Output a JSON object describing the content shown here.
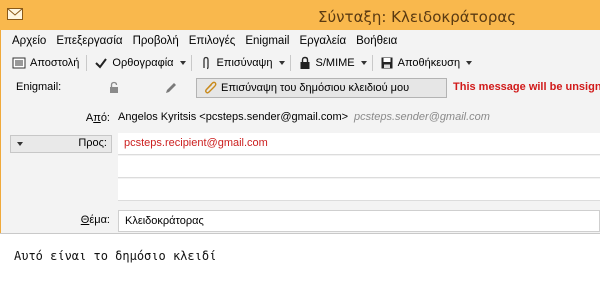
{
  "window": {
    "title": "Σύνταξη: Κλειδοκράτορας"
  },
  "menu": [
    "Αρχείο",
    "Επεξεργασία",
    "Προβολή",
    "Επιλογές",
    "Enigmail",
    "Εργαλεία",
    "Βοήθεια"
  ],
  "toolbar": {
    "send_label": "Αποστολή",
    "spelling_label": "Ορθογραφία",
    "attach_label": "Επισύναψη",
    "smime_label": "S/MIME",
    "save_label": "Αποθήκευση"
  },
  "enigmail_bar": {
    "label": "Enigmail:",
    "attach_key_label": "Επισύναψη του δημόσιου κλειδιού μου",
    "status_message": "This message will be unsign"
  },
  "header": {
    "from_label": "Από:",
    "from_value": "Angelos Kyritsis <pcsteps.sender@gmail.com>",
    "from_identity": "pcsteps.sender@gmail.com",
    "to_label": "Προς:",
    "to_value": "pcsteps.recipient@gmail.com",
    "subject_label": "Θέμα:",
    "subject_value": "Κλειδοκράτορας"
  },
  "body": {
    "text": "Αυτό είναι το δημόσιο κλειδί"
  },
  "colors": {
    "titlebar": "#f9b84d",
    "warning_red": "#d11a1a",
    "recipient_red": "#cc1f1f"
  }
}
